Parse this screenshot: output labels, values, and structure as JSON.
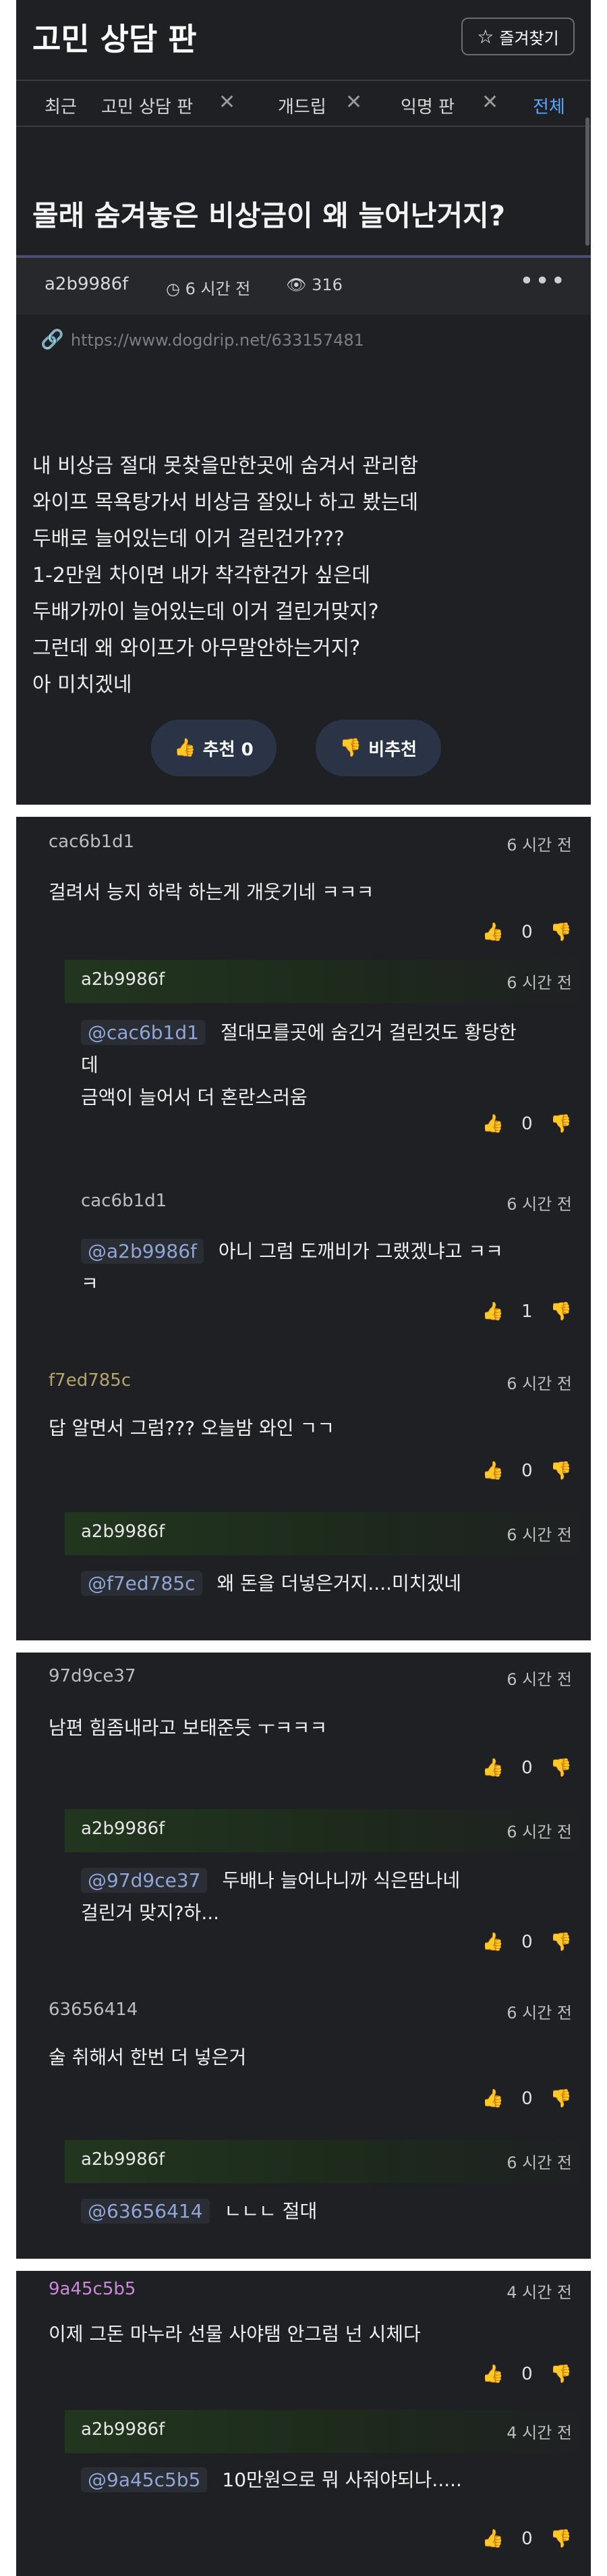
{
  "board": {
    "title": "고민 상담 판",
    "favorite_label": "즐겨찾기"
  },
  "tabs": {
    "recent": "최근",
    "items": [
      "고민 상담 판",
      "개드립",
      "익명 판"
    ],
    "all": "전체"
  },
  "post": {
    "title": "몰래 숨겨놓은 비상금이 왜 늘어난거지?",
    "author": "a2b9986f",
    "time": "6 시간 전",
    "views": "316",
    "url": "https://www.dogdrip.net/633157481",
    "body": [
      "내 비상금  절대 못찾을만한곳에 숨겨서 관리함",
      "와이프 목욕탕가서 비상금 잘있나 하고 봤는데",
      "두배로 늘어있는데 이거 걸린건가???",
      "1-2만원 차이면 내가 착각한건가 싶은데",
      "두배가까이 늘어있는데 이거 걸린거맞지?",
      "그런데 왜 와이프가 아무말안하는거지?",
      "아 미치겠네"
    ],
    "upvote_label": "추천 0",
    "downvote_label": "비추천"
  },
  "comments": [
    {
      "author": "cac6b1d1",
      "author_color": "#bdbdbd",
      "time": "6 시간 전",
      "text": [
        "걸려서 능지 하락 하는게 개웃기네 ㅋㅋㅋ"
      ],
      "likes": "0"
    },
    {
      "author": "a2b9986f",
      "author_color": "#e6e6e6",
      "time": "6 시간 전",
      "mention": "@cac6b1d1",
      "text": [
        "절대모를곳에 숨긴거 걸린것도 황당한",
        "데",
        "금액이 늘어서 더 혼란스러움"
      ],
      "likes": "0",
      "reply": true
    },
    {
      "author": "cac6b1d1",
      "author_color": "#bdbdbd",
      "time": "6 시간 전",
      "mention": "@a2b9986f",
      "text": [
        "아니 그럼 도깨비가 그랬겠냐고 ㅋㅋ",
        "ㅋ"
      ],
      "likes": "1",
      "reply": true
    },
    {
      "author": "f7ed785c",
      "author_color": "#b3a56b",
      "time": "6 시간 전",
      "text": [
        "답 알면서 그럼??? 오늘밤 와인 ㄱㄱ"
      ],
      "likes": "0"
    },
    {
      "author": "a2b9986f",
      "author_color": "#e6e6e6",
      "time": "6 시간 전",
      "mention": "@f7ed785c",
      "text": [
        "왜 돈을 더넣은거지....미치겠네"
      ],
      "reply": true
    },
    {
      "author": "97d9ce37",
      "author_color": "#bdbdbd",
      "time": "6 시간 전",
      "text": [
        "남편 힘좀내라고 보태준듯 ㅜㅋㅋㅋ"
      ],
      "likes": "0"
    },
    {
      "author": "a2b9986f",
      "author_color": "#e6e6e6",
      "time": "6 시간 전",
      "mention": "@97d9ce37",
      "text": [
        "두배나 늘어나니까 식은땀나네",
        "걸린거 맞지?하..."
      ],
      "likes": "0",
      "reply": true
    },
    {
      "author": "63656414",
      "author_color": "#bdbdbd",
      "time": "6 시간 전",
      "text": [
        "술 취해서 한번 더 넣은거"
      ],
      "likes": "0"
    },
    {
      "author": "a2b9986f",
      "author_color": "#e6e6e6",
      "time": "6 시간 전",
      "mention": "@63656414",
      "text": [
        "ㄴㄴㄴ 절대"
      ],
      "reply": true
    },
    {
      "author": "9a45c5b5",
      "author_color": "#c98ad8",
      "time": "4 시간 전",
      "text": [
        "이제 그돈 마누라 선물 사야탬 안그럼 넌 시체다"
      ],
      "likes": "0"
    },
    {
      "author": "a2b9986f",
      "author_color": "#e6e6e6",
      "time": "4 시간 전",
      "mention": "@9a45c5b5",
      "text": [
        "10만원으로 뭐 사줘야되나....."
      ],
      "likes": "0",
      "reply": true
    }
  ]
}
